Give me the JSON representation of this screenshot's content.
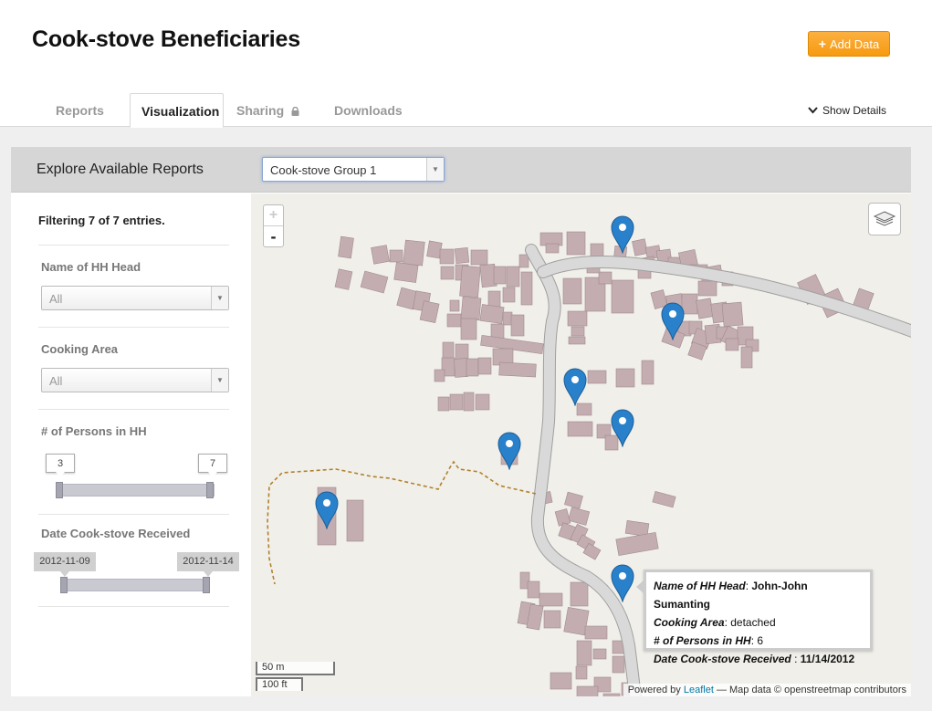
{
  "page": {
    "title": "Cook-stove Beneficiaries"
  },
  "toolbar": {
    "add_data_label": "Add Data",
    "add_icon": "plus-icon"
  },
  "tabs": [
    {
      "label": "Reports",
      "active": false
    },
    {
      "label": "Visualization",
      "active": true
    },
    {
      "label": "Sharing",
      "active": false,
      "icon": "lock-icon"
    },
    {
      "label": "Downloads",
      "active": false
    }
  ],
  "show_details_label": "Show Details",
  "explore": {
    "label": "Explore Available Reports",
    "selected_report": "Cook-stove Group 1"
  },
  "filters": {
    "count_text": "Filtering 7 of 7 entries.",
    "hh_head": {
      "label": "Name of HH Head",
      "value": "All"
    },
    "cooking_area": {
      "label": "Cooking Area",
      "value": "All"
    },
    "persons": {
      "label": "# of Persons in HH",
      "min": "3",
      "max": "7"
    },
    "date": {
      "label": "Date Cook-stove Received",
      "min": "2012-11-09",
      "max": "2012-11-14"
    }
  },
  "map": {
    "zoom_in": "+",
    "zoom_out": "-",
    "popup": {
      "hh_head_label": "Name of HH Head",
      "hh_head_value": "John-John Sumanting",
      "cooking_area_label": "Cooking Area",
      "cooking_area_value": "detached",
      "persons_label": "# of Persons in HH",
      "persons_value": "6",
      "date_label": "Date Cook-stove Received",
      "date_value": "11/14/2012"
    },
    "scale_m": "50 m",
    "scale_ft": "100 ft",
    "attribution_prefix": "Powered by",
    "attribution_link": "Leaflet",
    "attribution_suffix": "— Map data © openstreetmap contributors"
  },
  "colors": {
    "accent": "#f7a01e",
    "marker": "#2a81cb",
    "building": "#c4adb1",
    "map_bg": "#f1efe9"
  }
}
